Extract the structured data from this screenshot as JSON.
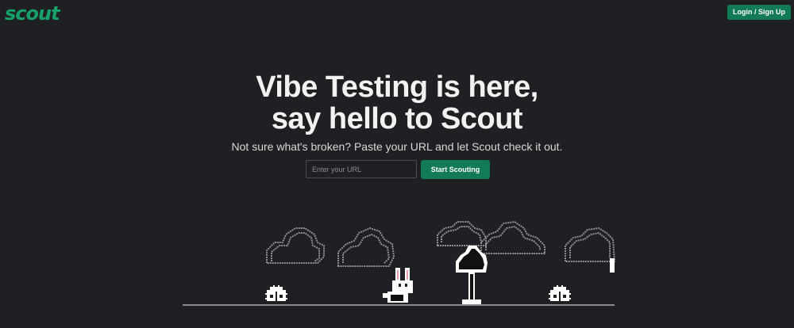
{
  "header": {
    "logo_text": "scout",
    "login_label": "Login / Sign Up"
  },
  "hero": {
    "title_line1": "Vibe Testing is here,",
    "title_line2": "say hello to Scout",
    "subtitle": "Not sure what's broken? Paste your URL and let Scout check it out."
  },
  "search": {
    "placeholder": "Enter your URL",
    "value": "",
    "button_label": "Start Scouting"
  },
  "colors": {
    "background": "#1f2023",
    "brand": "#16a06a",
    "button": "#127a55"
  },
  "scene": {
    "elements": [
      "cloud-icon",
      "cloud-icon",
      "cloud-icon",
      "cloud-icon",
      "cloud-icon",
      "bunny-icon",
      "bug-icon",
      "bug-icon",
      "tree-icon"
    ]
  }
}
